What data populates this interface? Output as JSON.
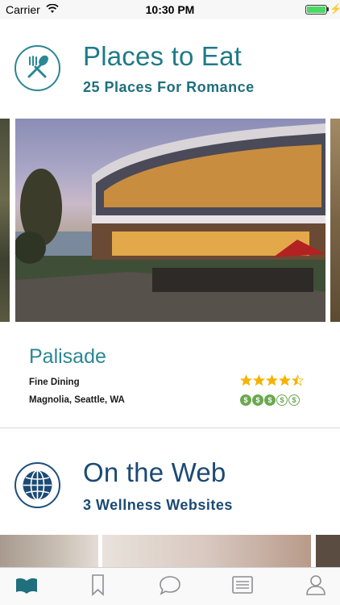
{
  "status_bar": {
    "carrier": "Carrier",
    "time": "10:30 PM",
    "battery_level": 1.0
  },
  "sections": [
    {
      "icon": "utensils-icon",
      "title": "Places to Eat",
      "subtitle": "25 Places For Romance",
      "accent_color": "#2b8793"
    },
    {
      "icon": "globe-icon",
      "title": "On the Web",
      "subtitle": "3 Wellness Websites",
      "accent_color": "#1b4a74"
    }
  ],
  "featured": {
    "name": "Palisade",
    "category": "Fine Dining",
    "location": "Magnolia, Seattle, WA",
    "rating": 4.5,
    "rating_max": 5,
    "price_level": 3,
    "price_max": 5,
    "price_symbol": "$"
  },
  "tab_bar": {
    "items": [
      {
        "icon": "book-icon",
        "active": true
      },
      {
        "icon": "bookmark-icon",
        "active": false
      },
      {
        "icon": "chat-bubble-icon",
        "active": false
      },
      {
        "icon": "list-icon",
        "active": false
      },
      {
        "icon": "user-icon",
        "active": false
      }
    ],
    "active_color": "#1f6f7d",
    "inactive_color": "#8e8e93"
  }
}
